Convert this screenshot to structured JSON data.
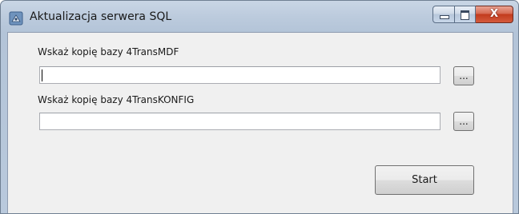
{
  "window": {
    "title": "Aktualizacja serwera SQL",
    "close_symbol": "X",
    "icons": {
      "app": "database-icon",
      "minimize": "minimize-icon",
      "maximize": "maximize-icon",
      "close": "close-icon"
    }
  },
  "form": {
    "mdf": {
      "label": "Wskaż kopię bazy 4TransMDF",
      "value": "",
      "browse_label": "..."
    },
    "konfig": {
      "label": "Wskaż kopię bazy 4TransKONFIG",
      "value": "",
      "browse_label": "..."
    },
    "start_label": "Start"
  },
  "colors": {
    "frame": "#b9c9dc",
    "client_bg": "#f0f0f0",
    "close_button": "#c23b1e"
  }
}
